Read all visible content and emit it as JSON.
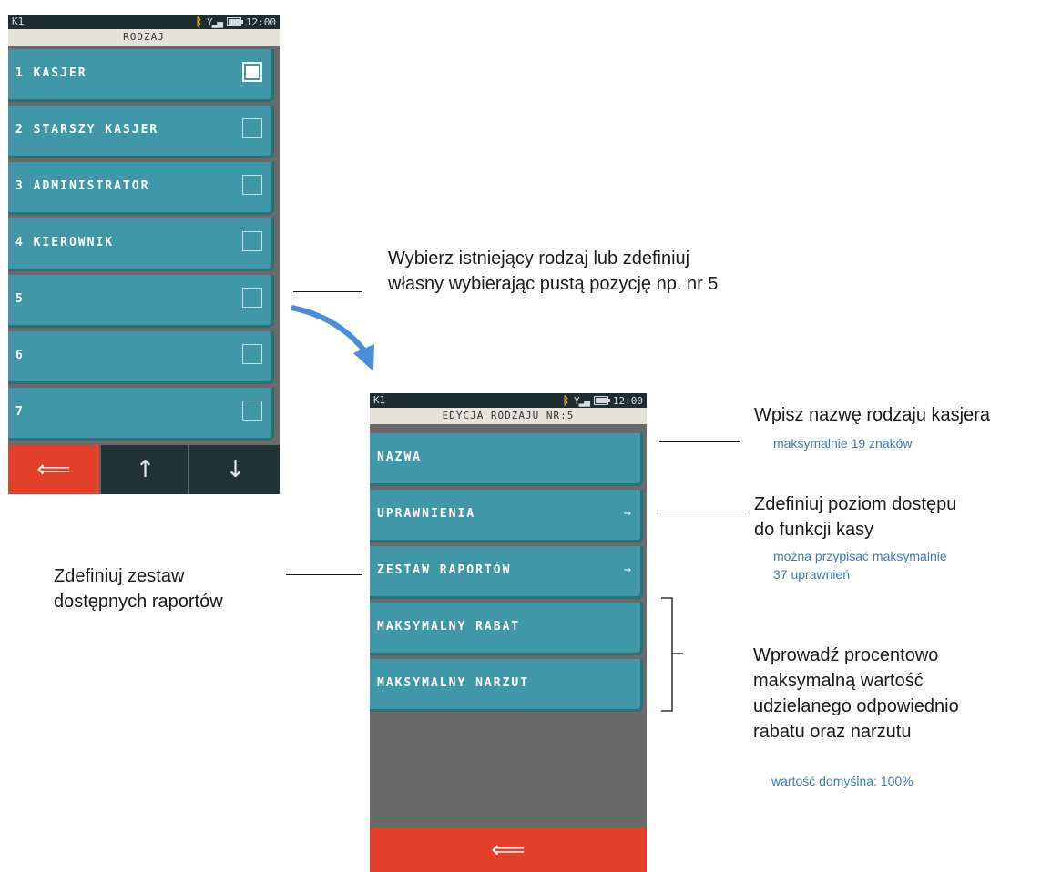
{
  "screen1": {
    "status": {
      "terminal": "K1",
      "time": "12:00"
    },
    "title": "RODZAJ",
    "items": [
      {
        "label": "1 KASJER",
        "checked": true
      },
      {
        "label": "2 STARSZY KASJER",
        "checked": false
      },
      {
        "label": "3 ADMINISTRATOR",
        "checked": false
      },
      {
        "label": "4 KIEROWNIK",
        "checked": false
      },
      {
        "label": "5",
        "checked": false
      },
      {
        "label": "6",
        "checked": false
      },
      {
        "label": "7",
        "checked": false
      }
    ],
    "buttons": {
      "back": "⟸",
      "up": "↑",
      "down": "↓"
    }
  },
  "screen2": {
    "status": {
      "terminal": "K1",
      "time": "12:00"
    },
    "title": "EDYCJA RODZAJU NR:5",
    "items": [
      {
        "label": "NAZWA"
      },
      {
        "label": "UPRAWNIENIA",
        "arrow": "→"
      },
      {
        "label": "ZESTAW RAPORTÓW",
        "arrow": "→"
      },
      {
        "label": "MAKSYMALNY RABAT"
      },
      {
        "label": "MAKSYMALNY NARZUT"
      }
    ],
    "buttons": {
      "back": "⟸"
    }
  },
  "annotations": {
    "choose_line1": "Wybierz istniejący rodzaj lub zdefiniuj",
    "choose_line2": "własny wybierając pustą pozycję np. nr 5",
    "name": "Wpisz nazwę rodzaju kasjera",
    "name_note": "maksymalnie 19 znaków",
    "perm_line1": "Zdefiniuj poziom dostępu",
    "perm_line2": "do funkcji kasy",
    "perm_note1": "można przypisać maksymalnie",
    "perm_note2": "37 uprawnień",
    "reports_line1": "Zdefiniuj zestaw",
    "reports_line2": "dostępnych raportów",
    "limit_line1": "Wprowadź procentowo",
    "limit_line2": "maksymalną wartość",
    "limit_line3": "udzielanego odpowiednio",
    "limit_line4": "rabatu oraz narzutu",
    "limit_note": "wartość domyślna: 100%"
  },
  "colors": {
    "item": "#3f97a8",
    "back_button": "#e3402a",
    "dark_button": "#1f3335",
    "note": "#3c7bbf",
    "arrow": "#4a8fd6"
  }
}
